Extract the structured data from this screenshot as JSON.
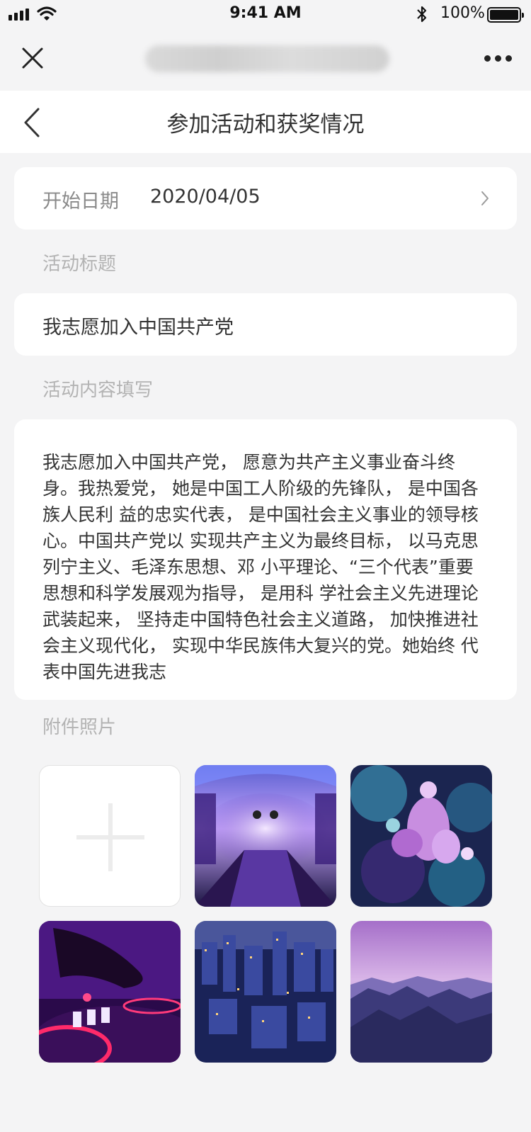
{
  "status_bar": {
    "time": "9:41 AM",
    "battery": "100%"
  },
  "nav": {
    "title": "参加活动和获奖情况"
  },
  "form": {
    "start_date_label": "开始日期",
    "start_date_value": "2020/04/05",
    "activity_title_label": "活动标题",
    "activity_title_value": "我志愿加入中国共产党",
    "activity_content_label": "活动内容填写",
    "activity_content_value": "我志愿加入中国共产党， 愿意为共产主义事业奋斗终身。我热爱党， 她是中国工人阶级的先锋队， 是中国各族人民利 益的忠实代表， 是中国社会主义事业的领导核心。中国共产党以 实现共产主义为最终目标， 以马克思列宁主义、毛泽东思想、邓 小平理论、“三个代表”重要思想和科学发展观为指导， 是用科 学社会主义先进理论武装起来， 坚持走中国特色社会主义道路，  加快推进社会主义现代化， 实现中华民族伟大复兴的党。她始终 代表中国先进我志",
    "attachments_label": "附件照片"
  },
  "photos": [
    {
      "icon": "add-photo-plus-icon"
    },
    {
      "subject": "purple-lit subway tunnel"
    },
    {
      "subject": "purple and teal abstract flower"
    },
    {
      "subject": "hand on DJ turntable"
    },
    {
      "subject": "city skyline at night from above"
    },
    {
      "subject": "purple mountain range at dusk"
    }
  ],
  "colors": {
    "background": "#f4f4f5",
    "card": "#ffffff",
    "label_gray": "#8a8a8a",
    "section_gray": "#b3b3b3",
    "text": "#333333"
  }
}
